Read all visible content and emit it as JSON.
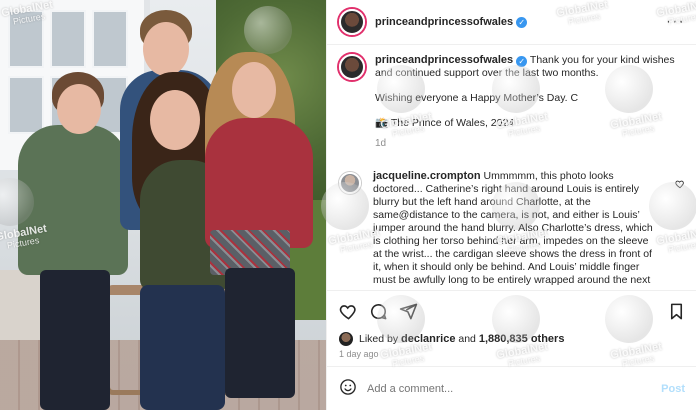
{
  "header": {
    "username": "princeandprincessofwales",
    "more_icon": "more-dots-icon"
  },
  "post": {
    "username": "princeandprincessofwales",
    "caption_line1": "Thank you for your kind wishes",
    "caption_line2": "and continued support over the last two months.",
    "caption_line3": "Wishing everyone a Happy Mother’s Day. C",
    "caption_line4": "The Prince of Wales, 2024",
    "camera_emoji": "📸",
    "time": "1d"
  },
  "comment": {
    "username": "jacqueline.crompton",
    "text_lines": [
      "Ummmmm, this photo looks",
      "doctored... Catherine’s right hand around Louis is entirely",
      "blurry but the left hand around Charlotte, at the",
      "same@distance to the camera, is not, and either is Louis’",
      "jumper around the hand blurry. Also Charlotte’s dress, which",
      "is clothing her torso behind her arm, impedes on the sleeve",
      "at the wrist... the cardigan sleeve shows the dress in front of",
      "it, when it should only be behind. And Louis’ middle finger",
      "must be awfully long to be entirely wrapped around the next"
    ]
  },
  "actions": {
    "like_icon": "heart-icon",
    "comment_icon": "comment-icon",
    "share_icon": "send-icon",
    "save_icon": "bookmark-icon"
  },
  "likes": {
    "prefix": "Liked by",
    "user": "declanrice",
    "middle": "and",
    "count": "1,880,835 others",
    "time": "1 day ago"
  },
  "composer": {
    "placeholder": "Add a comment...",
    "post_label": "Post",
    "emoji_icon": "emoji-icon"
  },
  "watermark": {
    "brand": "GlobalNet",
    "sub": "Pictures"
  },
  "colors": {
    "accent": "#3897f0",
    "story_ring": "#e1306c",
    "text": "#262626",
    "muted": "#8e8e8e"
  }
}
